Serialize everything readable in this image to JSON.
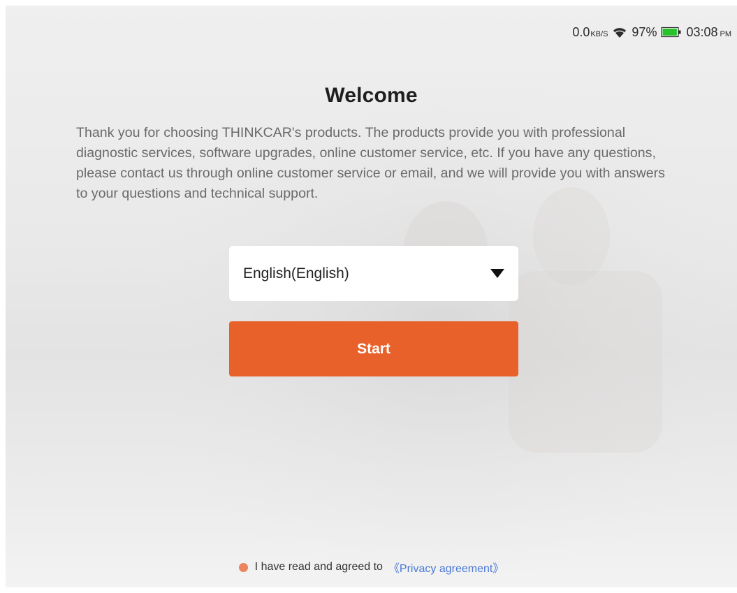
{
  "colors": {
    "accent": "#e8612a",
    "link": "#4a78d6",
    "radio": "#ec8460"
  },
  "status_bar": {
    "speed_value": "0.0",
    "speed_unit": "KB/S",
    "battery_percent": "97%",
    "battery_level": 0.97,
    "time": "03:08",
    "ampm": "PM",
    "icons": [
      "wifi-icon",
      "battery-icon"
    ]
  },
  "welcome": {
    "title": "Welcome",
    "description": "Thank you for choosing THINKCAR's products. The products provide you with professional diagnostic services, software upgrades, online customer service, etc. If you have any questions, please contact us through online customer service or email, and we will provide you with answers to your questions and technical support."
  },
  "language_select": {
    "selected": "English(English)",
    "icon": "caret-down-icon"
  },
  "start_button": {
    "label": "Start"
  },
  "agreement": {
    "text": "I have read and agreed to",
    "link": "《Privacy agreement》"
  }
}
